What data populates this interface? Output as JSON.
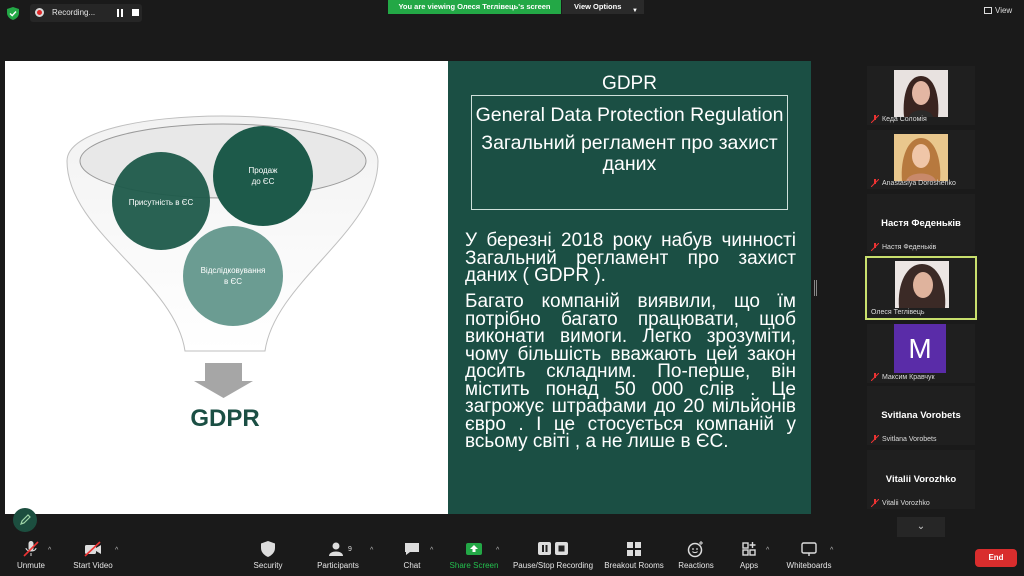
{
  "topbar": {
    "recording_label": "Recording...",
    "viewing_banner": "You are viewing Олеся Теглівець's screen",
    "view_options_label": "View Options",
    "view_button_label": "View"
  },
  "slide": {
    "funnel": {
      "circle_presence": "Присутність в ЄС",
      "circle_sales_1": "Продаж",
      "circle_sales_2": "до ЄС",
      "circle_tracking_1": "Відслідковування",
      "circle_tracking_2": "в ЄС",
      "result_label": "GDPR"
    },
    "right": {
      "heading": "GDPR",
      "definition_en": "General Data Protection Regulation",
      "definition_ua": "Загальний регламент про захист даних",
      "paragraph_1": "У березні 2018 року набув чинності Загальний регламент про захист даних ( GDPR ).",
      "paragraph_2": "Багато компаній виявили, що їм потрібно багато працювати, щоб виконати вимоги. Легко зрозуміти, чому більшість вважають цей закон досить складним. По-перше, він містить понад 50 000 слів . Це загрожує штрафами до 20 мільйонів євро . І це стосується компаній у всьому світі , а не лише в ЄС."
    },
    "colors": {
      "dark_green": "#1b4f44",
      "circle_dark": "#1d5a4a",
      "circle_light": "#6b9c92"
    }
  },
  "participants": [
    {
      "name": "Кеда Соломія",
      "type": "photo"
    },
    {
      "name": "Anastasiya Doroshenko",
      "type": "photo"
    },
    {
      "name": "Настя Феденьків",
      "display": "Настя Феденьків",
      "type": "name"
    },
    {
      "name": "Олеся Теглівець",
      "type": "photo",
      "active": true
    },
    {
      "name": "Максим Кравчук",
      "avatar_letter": "M",
      "type": "avatar"
    },
    {
      "name": "Svitlana Vorobets",
      "display": "Svitlana Vorobets",
      "type": "name"
    },
    {
      "name": "Vitalii Vorozhko",
      "display": "Vitalii Vorozhko",
      "type": "name"
    }
  ],
  "toolbar": {
    "unmute": "Unmute",
    "start_video": "Start Video",
    "security": "Security",
    "participants": "Participants",
    "participants_count": "9",
    "chat": "Chat",
    "share_screen": "Share Screen",
    "pause_stop_recording": "Pause/Stop Recording",
    "breakout_rooms": "Breakout Rooms",
    "reactions": "Reactions",
    "apps": "Apps",
    "whiteboards": "Whiteboards",
    "end": "End"
  }
}
